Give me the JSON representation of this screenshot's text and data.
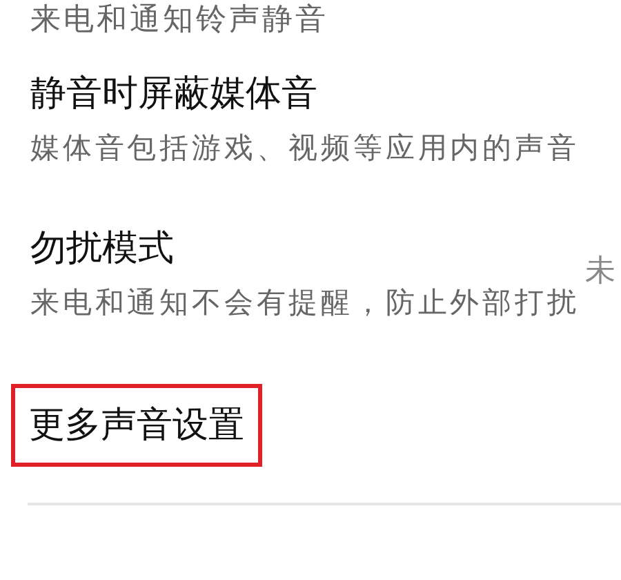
{
  "top_subtitle": "来电和通知铃声静音",
  "items": [
    {
      "title": "静音时屏蔽媒体音",
      "subtitle": "媒体音包括游戏、视频等应用内的声音",
      "highlighted": false
    },
    {
      "title": "勿扰模式",
      "subtitle": "来电和通知不会有提醒，防止外部打扰",
      "value": "未",
      "highlighted": false
    },
    {
      "title": "更多声音设置",
      "highlighted": true
    }
  ]
}
